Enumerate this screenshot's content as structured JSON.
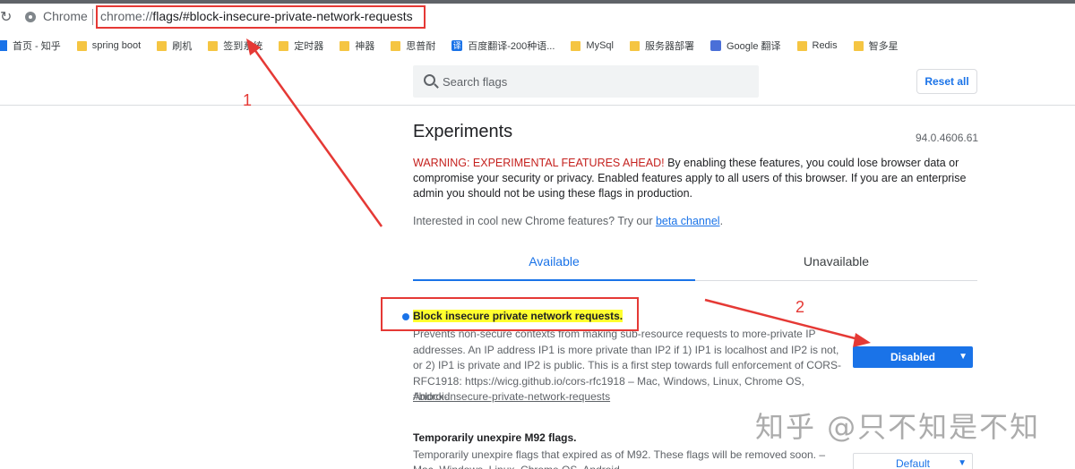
{
  "browser": {
    "chrome_label": "Chrome",
    "url_scheme": "chrome://",
    "url_host": "flags",
    "url_fragment": "/#block-insecure-private-network-requests"
  },
  "bookmarks": [
    "首页 - 知乎",
    "spring boot",
    "刷机",
    "签到系统",
    "定时器",
    "神器",
    "思普耐",
    "百度翻译-200种语...",
    "MySql",
    "服务器部署",
    "Google 翻译",
    "Redis",
    "智多星"
  ],
  "search": {
    "placeholder": "Search flags"
  },
  "reset_label": "Reset all",
  "page": {
    "title": "Experiments",
    "version": "94.0.4606.61",
    "warning_red": "WARNING: EXPERIMENTAL FEATURES AHEAD!",
    "warning_rest": " By enabling these features, you could lose browser data or compromise your security or privacy. Enabled features apply to all users of this browser. If you are an enterprise admin you should not be using these flags in production.",
    "interest_text": "Interested in cool new Chrome features? Try our ",
    "interest_link": "beta channel",
    "interest_end": "."
  },
  "tabs": {
    "available": "Available",
    "unavailable": "Unavailable"
  },
  "experiments": [
    {
      "name": "Block insecure private network requests.",
      "description": "Prevents non-secure contexts from making sub-resource requests to more-private IP addresses. An IP address IP1 is more private than IP2 if 1) IP1 is localhost and IP2 is not, or 2) IP1 is private and IP2 is public. This is a first step towards full enforcement of CORS-RFC1918: https://wicg.github.io/cors-rfc1918 – Mac, Windows, Linux, Chrome OS, Android",
      "link": "#block-insecure-private-network-requests",
      "selected": "Disabled"
    },
    {
      "name": "Temporarily unexpire M92 flags.",
      "description": "Temporarily unexpire flags that expired as of M92. These flags will be removed soon. – Mac, Windows, Linux, Chrome OS, Android",
      "selected": "Default"
    }
  ],
  "annotations": {
    "one": "1",
    "two": "2",
    "color": "#e53935"
  },
  "watermark": "知乎 @只不知是不知"
}
